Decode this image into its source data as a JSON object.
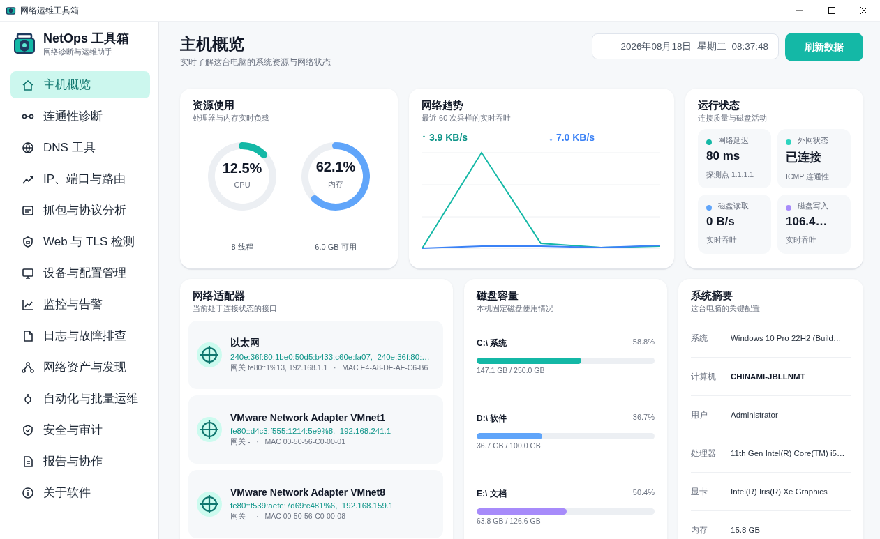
{
  "window": {
    "title": "网络运维工具箱"
  },
  "brand": {
    "name": "NetOps 工具箱",
    "tagline": "网络诊断与运维助手"
  },
  "sidebar": {
    "items": [
      {
        "label": "主机概览",
        "selected": true
      },
      {
        "label": "连通性诊断",
        "selected": false
      },
      {
        "label": "DNS 工具",
        "selected": false
      },
      {
        "label": "IP、端口与路由",
        "selected": false
      },
      {
        "label": "抓包与协议分析",
        "selected": false
      },
      {
        "label": "Web 与 TLS 检测",
        "selected": false
      },
      {
        "label": "设备与配置管理",
        "selected": false
      },
      {
        "label": "监控与告警",
        "selected": false
      },
      {
        "label": "日志与故障排查",
        "selected": false
      },
      {
        "label": "网络资产与发现",
        "selected": false
      },
      {
        "label": "自动化与批量运维",
        "selected": false
      },
      {
        "label": "安全与审计",
        "selected": false
      },
      {
        "label": "报告与协作",
        "selected": false
      },
      {
        "label": "关于软件",
        "selected": false
      }
    ]
  },
  "header": {
    "title": "主机概览",
    "subtitle": "实时了解这台电脑的系统资源与网络状态",
    "datetime": "2026年08月18日  星期二  08:37:48",
    "refresh_button": "刷新数据"
  },
  "resources": {
    "title": "资源使用",
    "subtitle": "处理器与内存实时负载",
    "gauges": [
      {
        "value": "12.5%",
        "label": "CPU",
        "color": "#14b8a6",
        "footer": "8 线程"
      },
      {
        "value": "62.1%",
        "label": "内存",
        "color": "#60a5fa",
        "footer": "6.0 GB 可用"
      }
    ]
  },
  "network": {
    "title": "网络趋势",
    "subtitle": "最近 60 次采样的实时吞吐",
    "upload": "↑ 3.9 KB/s",
    "download": "↓ 7.0 KB/s"
  },
  "status": {
    "title": "运行状态",
    "subtitle": "连接质量与磁盘活动",
    "tiles": [
      {
        "label": "网络延迟",
        "value": "80 ms",
        "note": "探测点 1.1.1.1",
        "color": "#14b8a6"
      },
      {
        "label": "外网状态",
        "value": "已连接",
        "note": "ICMP 连通性",
        "color": "#2dd4bf"
      },
      {
        "label": "磁盘读取",
        "value": "0 B/s",
        "note": "实时吞吐",
        "color": "#60a5fa"
      },
      {
        "label": "磁盘写入",
        "value": "106.4…",
        "note": "实时吞吐",
        "color": "#a78bfa"
      }
    ]
  },
  "adapters": {
    "title": "网络适配器",
    "subtitle": "当前处于连接状态的接口",
    "items": [
      {
        "name": "以太网",
        "addresses": "240e:36f:80:1be0:50d5:b433:c60e:fa07,  240e:36f:80:…",
        "details": "网关 fe80::1%13, 192.168.1.1   ·   MAC E4-A8-DF-AF-C6-B6"
      },
      {
        "name": "VMware Network Adapter VMnet1",
        "addresses": "fe80::d4c3:f555:1214:5e9%8,  192.168.241.1",
        "details": "网关 -   ·   MAC 00-50-56-C0-00-01"
      },
      {
        "name": "VMware Network Adapter VMnet8",
        "addresses": "fe80::f539:aefe:7d69:c481%6,  192.168.159.1",
        "details": "网关 -   ·   MAC 00-50-56-C0-00-08"
      }
    ]
  },
  "disks": {
    "title": "磁盘容量",
    "subtitle": "本机固定磁盘使用情况",
    "items": [
      {
        "name": "C:\\ 系统",
        "percent": "58.8%",
        "usage": "147.1 GB / 250.0 GB",
        "level": 0.588,
        "color": "#14b8a6"
      },
      {
        "name": "D:\\ 软件",
        "percent": "36.7%",
        "usage": "36.7 GB / 100.0 GB",
        "level": 0.367,
        "color": "#60a5fa"
      },
      {
        "name": "E:\\ 文档",
        "percent": "50.4%",
        "usage": "63.8 GB / 126.6 GB",
        "level": 0.504,
        "color": "#a78bfa"
      }
    ]
  },
  "summary": {
    "title": "系统摘要",
    "subtitle": "这台电脑的关键配置",
    "rows": [
      {
        "label": "系统",
        "value": "Windows 10 Pro 22H2 (Build…",
        "emphasized": false
      },
      {
        "label": "计算机",
        "value": "CHINAMI-JBLLNMT",
        "emphasized": true
      },
      {
        "label": "用户",
        "value": "Administrator",
        "emphasized": false
      },
      {
        "label": "处理器",
        "value": "11th Gen Intel(R) Core(TM) i5…",
        "emphasized": false
      },
      {
        "label": "显卡",
        "value": "Intel(R) Iris(R) Xe Graphics",
        "emphasized": false
      },
      {
        "label": "内存",
        "value": "15.8 GB",
        "emphasized": false
      }
    ]
  }
}
